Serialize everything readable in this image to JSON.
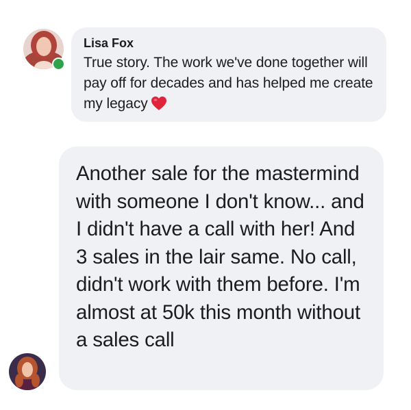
{
  "conversation": {
    "messages": [
      {
        "sender_name": "Lisa Fox",
        "text": "True story. The work we've done together will pay off for decades and has helped me create my legacy",
        "emoji": "heart",
        "avatar_icon": "profile-photo",
        "online": true
      },
      {
        "text": "Another sale for the mastermind with someone I don't know... and I didn't have a call with her! And 3 sales in the lair same. No call, didn't work with them before. I'm almost at 50k this month without a sales call",
        "avatar_icon": "profile-photo"
      }
    ]
  },
  "colors": {
    "bubble_bg": "#eff1f5",
    "text": "#1b1c1f",
    "online": "#31a24c",
    "heart": "#e0253a"
  }
}
